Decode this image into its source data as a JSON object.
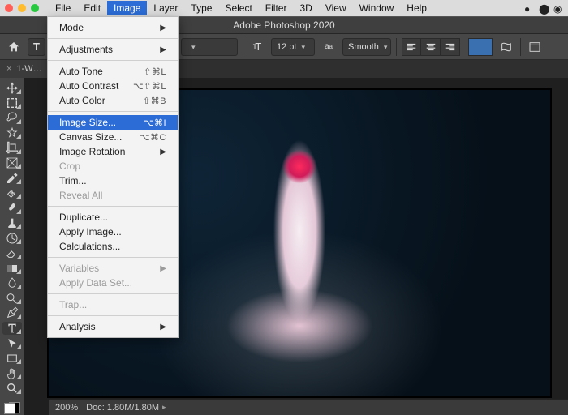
{
  "menubar": [
    "File",
    "Edit",
    "Image",
    "Layer",
    "Type",
    "Select",
    "Filter",
    "3D",
    "View",
    "Window",
    "Help"
  ],
  "menubar_open_index": 2,
  "app_title": "Adobe Photoshop 2020",
  "optionsbar": {
    "font_family": "",
    "font_style": "",
    "size_icon": "tT",
    "font_size": "12 pt",
    "aa_label": "aa",
    "aa_mode": "Smooth"
  },
  "doc_tab": {
    "label": "1-W…",
    "close": "×"
  },
  "status": {
    "zoom": "200%",
    "doc": "Doc: 1.80M/1.80M"
  },
  "image_menu": [
    {
      "type": "item",
      "label": "Mode",
      "sub": true
    },
    {
      "type": "sep"
    },
    {
      "type": "item",
      "label": "Adjustments",
      "sub": true
    },
    {
      "type": "sep"
    },
    {
      "type": "item",
      "label": "Auto Tone",
      "shortcut": "⇧⌘L"
    },
    {
      "type": "item",
      "label": "Auto Contrast",
      "shortcut": "⌥⇧⌘L"
    },
    {
      "type": "item",
      "label": "Auto Color",
      "shortcut": "⇧⌘B"
    },
    {
      "type": "sep"
    },
    {
      "type": "item",
      "label": "Image Size...",
      "shortcut": "⌥⌘I",
      "highlight": true
    },
    {
      "type": "item",
      "label": "Canvas Size...",
      "shortcut": "⌥⌘C"
    },
    {
      "type": "item",
      "label": "Image Rotation",
      "sub": true
    },
    {
      "type": "item",
      "label": "Crop",
      "disabled": true
    },
    {
      "type": "item",
      "label": "Trim..."
    },
    {
      "type": "item",
      "label": "Reveal All",
      "disabled": true
    },
    {
      "type": "sep"
    },
    {
      "type": "item",
      "label": "Duplicate..."
    },
    {
      "type": "item",
      "label": "Apply Image..."
    },
    {
      "type": "item",
      "label": "Calculations..."
    },
    {
      "type": "sep"
    },
    {
      "type": "item",
      "label": "Variables",
      "sub": true,
      "disabled": true
    },
    {
      "type": "item",
      "label": "Apply Data Set...",
      "disabled": true
    },
    {
      "type": "sep"
    },
    {
      "type": "item",
      "label": "Trap...",
      "disabled": true
    },
    {
      "type": "sep"
    },
    {
      "type": "item",
      "label": "Analysis",
      "sub": true
    }
  ],
  "tools": [
    {
      "name": "move-tool"
    },
    {
      "name": "rect-marquee-tool"
    },
    {
      "name": "lasso-tool"
    },
    {
      "name": "quick-select-tool"
    },
    {
      "name": "crop-tool"
    },
    {
      "name": "frame-tool"
    },
    {
      "name": "eyedropper-tool"
    },
    {
      "name": "healing-brush-tool"
    },
    {
      "name": "brush-tool"
    },
    {
      "name": "clone-stamp-tool"
    },
    {
      "name": "history-brush-tool"
    },
    {
      "name": "eraser-tool"
    },
    {
      "name": "gradient-tool"
    },
    {
      "name": "blur-tool"
    },
    {
      "name": "dodge-tool"
    },
    {
      "name": "pen-tool"
    },
    {
      "name": "type-tool",
      "selected": true
    },
    {
      "name": "path-select-tool"
    },
    {
      "name": "rectangle-tool"
    },
    {
      "name": "hand-tool"
    },
    {
      "name": "zoom-tool"
    }
  ]
}
